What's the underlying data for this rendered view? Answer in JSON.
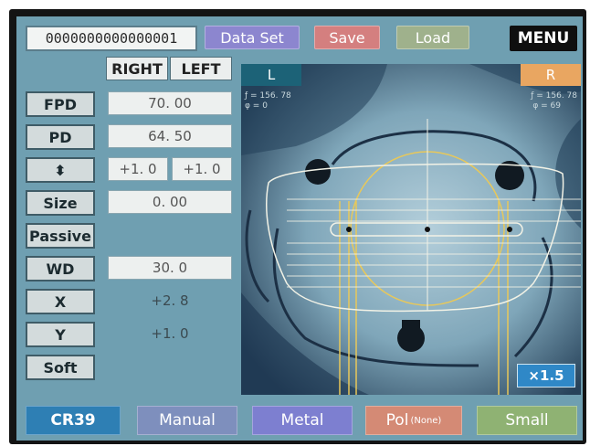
{
  "header": {
    "serial_number": "0000000000000001",
    "data_set_label": "Data Set",
    "save_label": "Save",
    "load_label": "Load",
    "menu_label": "MENU"
  },
  "columns": {
    "right": "RIGHT",
    "left": "LEFT"
  },
  "params": {
    "fpd": {
      "label": "FPD",
      "value": "70. 00"
    },
    "pd": {
      "label": "PD",
      "value": "64. 50"
    },
    "height": {
      "label_icon": "up-down-arrows-icon",
      "label_glyph": "⬍",
      "right": "+1. 0",
      "left": "+1. 0"
    },
    "size": {
      "label": "Size",
      "value": "0. 00"
    },
    "passive": {
      "label": "Passive"
    },
    "wd": {
      "label": "WD",
      "value": "30. 0"
    },
    "x": {
      "label": "X",
      "value": "+2. 8"
    },
    "y": {
      "label": "Y",
      "value": "+1. 0"
    },
    "soft": {
      "label": "Soft"
    }
  },
  "viewer": {
    "tab_left": "L",
    "tab_right": "R",
    "left_readout_1": "ƒ = 156. 78",
    "left_readout_2": "φ = 0",
    "right_readout_1": "ƒ = 156. 78",
    "right_readout_2": "φ = 69",
    "zoom_label": "×1.5"
  },
  "footer": {
    "material_label": "CR39",
    "mode_label": "Manual",
    "frame_label": "Metal",
    "pol_label": "Pol",
    "pol_sub": "(None)",
    "size_label": "Small"
  },
  "colors": {
    "screen_bg": "#6f9fb1",
    "tab_left": "#1c6277",
    "tab_right": "#e9a661",
    "overlay_white": "#f2f2e6",
    "overlay_yellow": "#e8c85a"
  }
}
